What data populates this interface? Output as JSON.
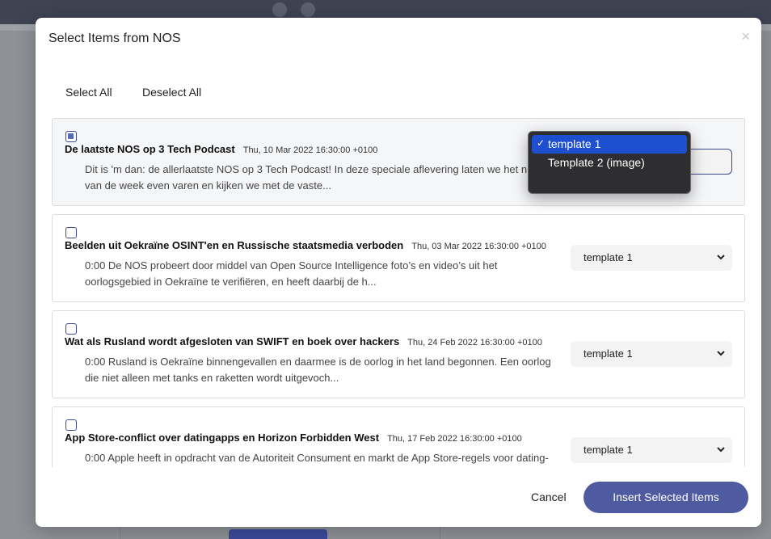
{
  "modal": {
    "title": "Select Items from NOS",
    "close_label": "×",
    "select_all_label": "Select All",
    "deselect_all_label": "Deselect All",
    "cancel_label": "Cancel",
    "insert_label": "Insert Selected Items"
  },
  "items": [
    {
      "checked": true,
      "title": "De laatste NOS op 3 Tech Podcast",
      "date": "Thu, 10 Mar 2022 16:30:00 +0100",
      "desc": "Dit is 'm dan: de allerlaatste NOS op 3 Tech Podcast! In deze speciale aflevering laten we het nieuws van de week even varen en kijken we met de vaste...",
      "template": "template 1"
    },
    {
      "checked": false,
      "title": "Beelden uit Oekraïne OSINT'en en Russische staatsmedia verboden",
      "date": "Thu, 03 Mar 2022 16:30:00 +0100",
      "desc": "0:00 De NOS probeert door middel van Open Source Intelligence foto’s en video’s uit het oorlogsgebied in Oekraïne te verifiëren, en heeft daarbij de h...",
      "template": "template 1"
    },
    {
      "checked": false,
      "title": "Wat als Rusland wordt afgesloten van SWIFT en boek over hackers",
      "date": "Thu, 24 Feb 2022 16:30:00 +0100",
      "desc": "0:00 Rusland is Oekraïne binnengevallen en daarmee is de oorlog in het land begonnen. Een oorlog die niet alleen met tanks en raketten wordt uitgevoch...",
      "template": "template 1"
    },
    {
      "checked": false,
      "title": "App Store-conflict over datingapps en Horizon Forbidden West",
      "date": "Thu, 17 Feb 2022 16:30:00 +0100",
      "desc": "0:00 Apple heeft in opdracht van de Autoriteit Consument en markt de App Store-regels voor dating-",
      "template": "template 1"
    }
  ],
  "dropdown": {
    "options": [
      "template 1",
      "Template 2 (image)"
    ],
    "selected": "template 1",
    "check_glyph": "✓"
  },
  "colors": {
    "primary": "#4f5ba1",
    "dropdown_bg": "#2e2e30",
    "dropdown_highlight": "#1f4fd1"
  }
}
